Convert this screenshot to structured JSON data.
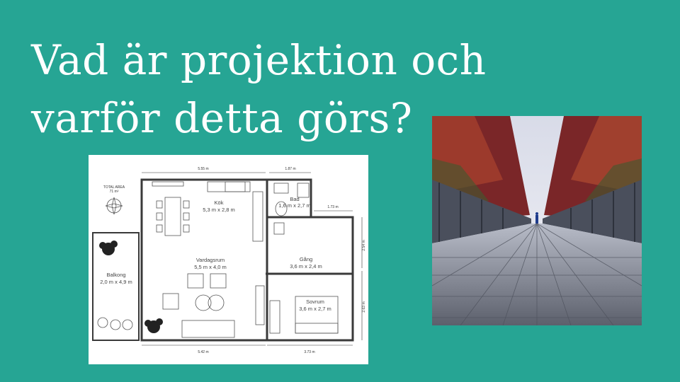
{
  "slide": {
    "title_line1": "Vad är projektion och",
    "title_line2": "varför detta görs?",
    "background_color": "#26a594"
  },
  "floorplan": {
    "total_area_label": "TOTAL AREA",
    "total_area_value": "71 m²",
    "dims": {
      "top_left": "5.55 m",
      "top_right": "1.87 m",
      "right_small": "1.73 m",
      "right_upper": "2.54 m",
      "right_lower": "2.63 m",
      "bottom_left": "5.42 m",
      "bottom_right": "3.73 m"
    },
    "rooms": [
      {
        "name": "Kök",
        "size": "5,3 m x 2,8 m"
      },
      {
        "name": "Bad",
        "size": "1,6 m x 2,7 m"
      },
      {
        "name": "Vardagsrum",
        "size": "5,5 m x 4,0 m"
      },
      {
        "name": "Gång",
        "size": "3,6 m x 2,4 m"
      },
      {
        "name": "Balkong",
        "size": "2,0 m x 4,9 m"
      },
      {
        "name": "Sovrum",
        "size": "3,6 m x 2,7 m"
      }
    ]
  },
  "photo": {
    "subject": "walkway-perspective-photo",
    "colors": {
      "sky": "#e6e8f0",
      "foliage": "#8a2a28",
      "deck": "#7c7f8c"
    }
  }
}
